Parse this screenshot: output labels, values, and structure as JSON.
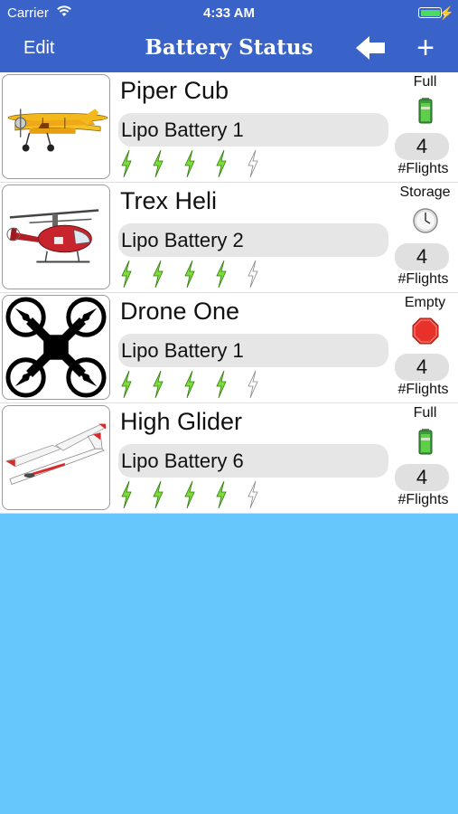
{
  "status_bar": {
    "carrier": "Carrier",
    "time": "4:33 AM"
  },
  "nav": {
    "edit_label": "Edit",
    "title": "Battery Status",
    "back_icon": "arrow-left-icon",
    "add_label": "+"
  },
  "rows": [
    {
      "aircraft": "Piper Cub",
      "battery": "Lipo Battery 1",
      "status": "Full",
      "status_icon": "full-battery-icon",
      "flights": "4",
      "flights_label": "#Flights",
      "charges_filled": 4,
      "charges_total": 5,
      "image": "biplane-image"
    },
    {
      "aircraft": "Trex Heli",
      "battery": "Lipo Battery 2",
      "status": "Storage",
      "status_icon": "clock-icon",
      "flights": "4",
      "flights_label": "#Flights",
      "charges_filled": 4,
      "charges_total": 5,
      "image": "helicopter-image"
    },
    {
      "aircraft": "Drone One",
      "battery": "Lipo Battery 1",
      "status": "Empty",
      "status_icon": "stop-sign-icon",
      "flights": "4",
      "flights_label": "#Flights",
      "charges_filled": 4,
      "charges_total": 5,
      "image": "quadcopter-image"
    },
    {
      "aircraft": "High Glider",
      "battery": "Lipo Battery 6",
      "status": "Full",
      "status_icon": "full-battery-icon",
      "flights": "4",
      "flights_label": "#Flights",
      "charges_filled": 4,
      "charges_total": 5,
      "image": "glider-image"
    }
  ],
  "colors": {
    "nav": "#3a63c9",
    "background": "#66c7fd",
    "bolt_green": "#7ddc3a",
    "stop_red": "#e8312a"
  }
}
